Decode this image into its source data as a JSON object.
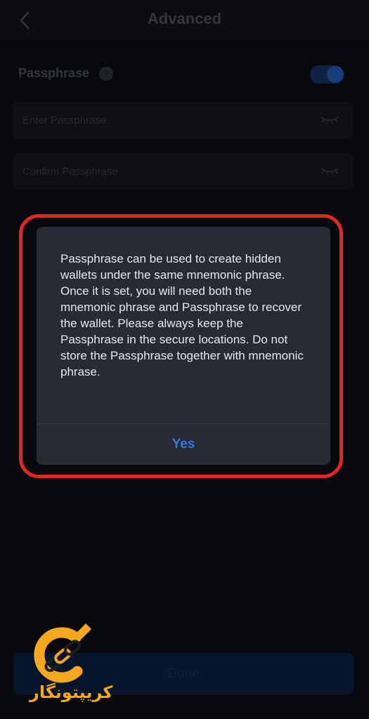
{
  "header": {
    "title": "Advanced"
  },
  "passphrase": {
    "label": "Passphrase",
    "help": "?",
    "enabled": true,
    "enter_placeholder": "Enter Passphrase",
    "confirm_placeholder": "Confirm Passphrase"
  },
  "dialog": {
    "message": "Passphrase can be used to create hidden wallets under the same mnemonic phrase. Once it is set, you will need both the mnemonic phrase and Passphrase to recover the wallet. Please always keep the Passphrase in the secure locations. Do not store the Passphrase together with mnemonic phrase.",
    "confirm_label": "Yes"
  },
  "footer": {
    "done_label": "Done"
  },
  "watermark": {
    "text": "کریپتونگار"
  },
  "colors": {
    "accent": "#2f7ad8",
    "highlight": "#e32524",
    "watermark": "#f5a81c"
  }
}
